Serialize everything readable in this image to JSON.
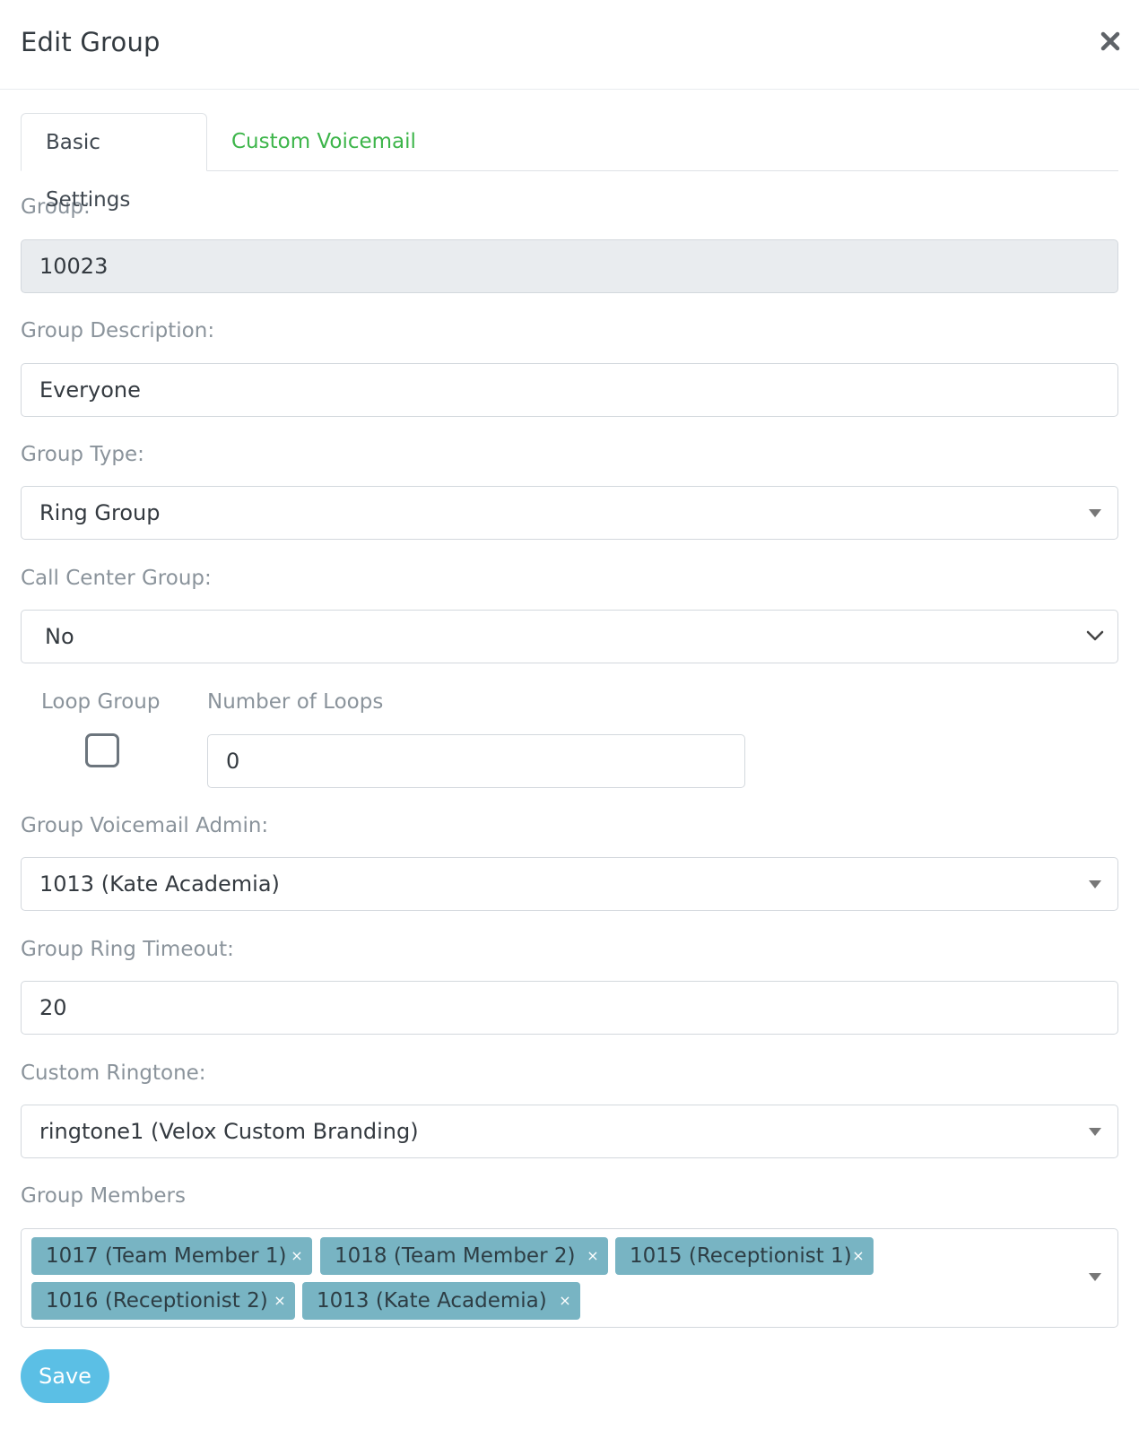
{
  "modal": {
    "title": "Edit Group"
  },
  "tabs": [
    {
      "label": "Basic Settings",
      "active": true
    },
    {
      "label": "Custom Voicemail",
      "active": false
    }
  ],
  "fields": {
    "group": {
      "label": "Group:",
      "value": "10023"
    },
    "description": {
      "label": "Group Description:",
      "value": "Everyone"
    },
    "type": {
      "label": "Group Type:",
      "value": "Ring Group"
    },
    "call_center": {
      "label": "Call Center Group:",
      "value": "No"
    },
    "loop_group": {
      "label": "Loop Group",
      "checked": false
    },
    "loops": {
      "label": "Number of Loops",
      "value": "0"
    },
    "voicemail_admin": {
      "label": "Group Voicemail Admin:",
      "value": "1013 (Kate Academia)"
    },
    "ring_timeout": {
      "label": "Group Ring Timeout:",
      "value": "20"
    },
    "ringtone": {
      "label": "Custom Ringtone:",
      "value": "ringtone1 (Velox Custom Branding)"
    },
    "members": {
      "label": "Group Members",
      "items": [
        "1017 (Team Member 1)",
        "1018 (Team Member 2)",
        "1015 (Receptionist 1)",
        "1016 (Receptionist 2)",
        "1013 (Kate Academia)"
      ],
      "remove_glyph": "×"
    }
  },
  "actions": {
    "save_label": "Save"
  },
  "colors": {
    "accent_green": "#3db54a",
    "chip_bg": "#78b4c3",
    "save_bg": "#5bbfe5",
    "readonly_bg": "#e9ecef"
  }
}
